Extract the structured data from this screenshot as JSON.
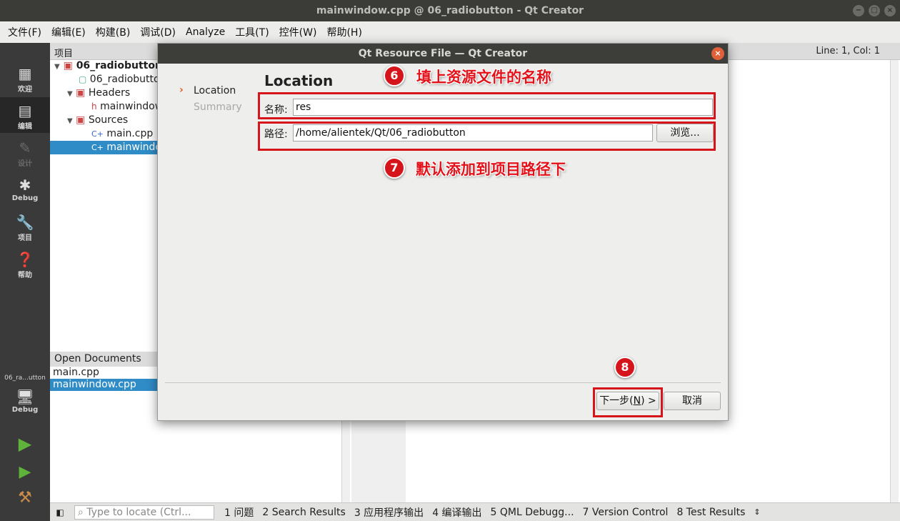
{
  "window": {
    "title": "mainwindow.cpp @ 06_radiobutton - Qt Creator",
    "controls": [
      "−",
      "□",
      "×"
    ]
  },
  "menubar": [
    "文件(F)",
    "编辑(E)",
    "构建(B)",
    "调试(D)",
    "Analyze",
    "工具(T)",
    "控件(W)",
    "帮助(H)"
  ],
  "modes": [
    {
      "label": "欢迎",
      "icon": "grid-icon"
    },
    {
      "label": "编辑",
      "icon": "edit-icon"
    },
    {
      "label": "设计",
      "icon": "pencil-icon"
    },
    {
      "label": "Debug",
      "icon": "bug-icon"
    },
    {
      "label": "项目",
      "icon": "wrench-icon"
    },
    {
      "label": "帮助",
      "icon": "help-icon"
    }
  ],
  "kit": {
    "project": "06_ra...utton",
    "label": "Debug"
  },
  "project_panel": {
    "title": "项目",
    "tree": [
      {
        "label": "06_radiobutton",
        "indent": 0
      },
      {
        "label": "06_radiobutton.pro",
        "indent": 2
      },
      {
        "label": "Headers",
        "indent": 1
      },
      {
        "label": "mainwindow.h",
        "indent": 2
      },
      {
        "label": "Sources",
        "indent": 1
      },
      {
        "label": "main.cpp",
        "indent": 2
      },
      {
        "label": "mainwindow.cpp",
        "indent": 2
      }
    ]
  },
  "editor_header": {
    "position": "Line: 1, Col: 1"
  },
  "open_documents": {
    "title": "Open Documents",
    "items": [
      "main.cpp",
      "mainwindow.cpp"
    ]
  },
  "statusbar": {
    "locate_placeholder": "Type to locate (Ctrl...",
    "tabs": [
      "1 问题",
      "2 Search Results",
      "3 应用程序输出",
      "4 编译输出",
      "5 QML Debugg...",
      "7 Version Control",
      "8 Test Results"
    ]
  },
  "dialog": {
    "title": "Qt Resource File — Qt Creator",
    "steps": [
      "Location",
      "Summary"
    ],
    "heading": "Location",
    "name_label": "名称:",
    "name_value": "res",
    "path_label": "路径:",
    "path_value": "/home/alientek/Qt/06_radiobutton",
    "browse_label": "浏览...",
    "next_label": "下一步(N) >",
    "cancel_label": "取消"
  },
  "annotations": [
    {
      "number": "6",
      "text": "填上资源文件的名称"
    },
    {
      "number": "7",
      "text": "默认添加到项目路径下"
    },
    {
      "number": "8",
      "text": ""
    }
  ],
  "colors": {
    "highlight": "#d5151b",
    "selection": "#308cc6",
    "sidebar": "#3a3a3a"
  }
}
